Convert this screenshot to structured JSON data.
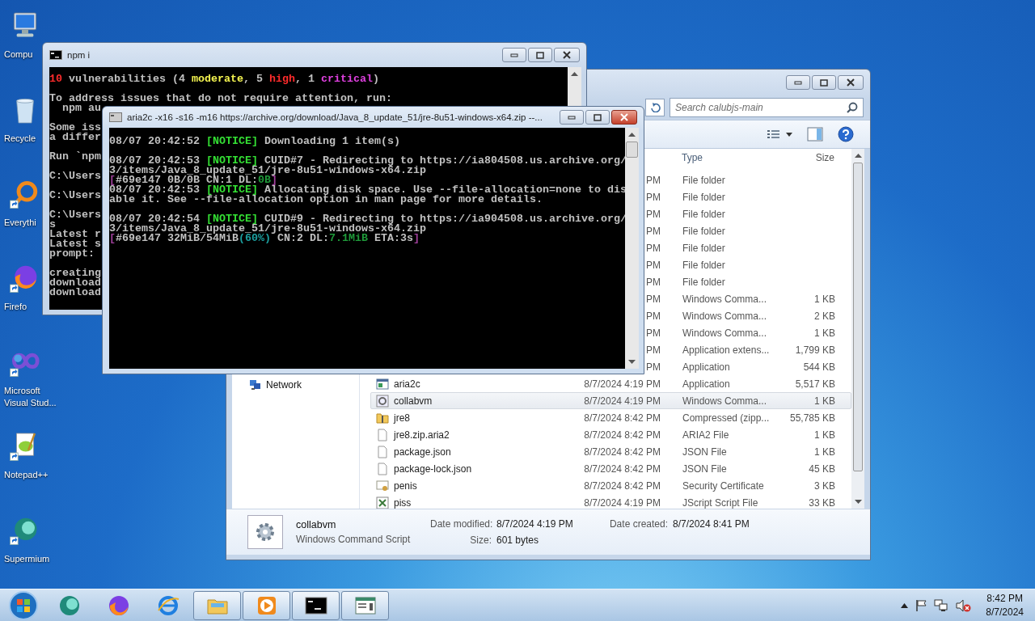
{
  "desktop_icons": [
    {
      "label": "Compu",
      "kind": "computer",
      "shortcut": false
    },
    {
      "label": "Recycle",
      "kind": "bin",
      "shortcut": false
    },
    {
      "label": "Everythi",
      "kind": "ring",
      "shortcut": true
    },
    {
      "label": "Firefo",
      "kind": "fox",
      "shortcut": true
    },
    {
      "label": "Microsoft Visual Stud...",
      "kind": "loop",
      "shortcut": true
    },
    {
      "label": "Notepad++",
      "kind": "notepad",
      "shortcut": true
    },
    {
      "label": "Supermium",
      "kind": "sphere",
      "shortcut": true
    }
  ],
  "explorer": {
    "search": {
      "placeholder": "Search calubjs-main"
    },
    "columns": [
      "Type",
      "Size"
    ],
    "nav_items": [
      "Network"
    ],
    "rows": [
      {
        "date": "PM",
        "type": "File folder",
        "selected": false
      },
      {
        "date": "PM",
        "type": "File folder",
        "selected": false
      },
      {
        "date": "PM",
        "type": "File folder",
        "selected": false
      },
      {
        "date": "PM",
        "type": "File folder",
        "selected": false
      },
      {
        "date": "PM",
        "type": "File folder",
        "selected": false
      },
      {
        "date": "PM",
        "type": "File folder",
        "selected": false
      },
      {
        "date": "PM",
        "type": "File folder",
        "selected": false
      },
      {
        "date": "PM",
        "type": "Windows Comma...",
        "size": "1 KB",
        "selected": false
      },
      {
        "date": "PM",
        "type": "Windows Comma...",
        "size": "2 KB",
        "selected": false
      },
      {
        "date": "PM",
        "type": "Windows Comma...",
        "size": "1 KB",
        "selected": false
      },
      {
        "date": "PM",
        "type": "Application extens...",
        "size": "1,799 KB",
        "selected": false
      },
      {
        "date": "PM",
        "type": "Application",
        "size": "544 KB",
        "selected": false
      },
      {
        "name": "aria2c",
        "kind": "app",
        "date": "8/7/2024 4:19 PM",
        "type": "Application",
        "size": "5,517 KB",
        "selected": false
      },
      {
        "name": "collabvm",
        "kind": "script",
        "date": "8/7/2024 4:19 PM",
        "type": "Windows Comma...",
        "size": "1 KB",
        "selected": true
      },
      {
        "name": "jre8",
        "kind": "zip",
        "date": "8/7/2024 8:42 PM",
        "type": "Compressed (zipp...",
        "size": "55,785 KB",
        "selected": false
      },
      {
        "name": "jre8.zip.aria2",
        "kind": "file",
        "date": "8/7/2024 8:42 PM",
        "type": "ARIA2 File",
        "size": "1 KB",
        "selected": false
      },
      {
        "name": "package.json",
        "kind": "file",
        "date": "8/7/2024 8:42 PM",
        "type": "JSON File",
        "size": "1 KB",
        "selected": false
      },
      {
        "name": "package-lock.json",
        "kind": "file",
        "date": "8/7/2024 8:42 PM",
        "type": "JSON File",
        "size": "45 KB",
        "selected": false
      },
      {
        "name": "penis",
        "kind": "cert",
        "date": "8/7/2024 8:42 PM",
        "type": "Security Certificate",
        "size": "3 KB",
        "selected": false
      },
      {
        "name": "piss",
        "kind": "jscript",
        "date": "8/7/2024 4:19 PM",
        "type": "JScript Script File",
        "size": "33 KB",
        "selected": false
      }
    ],
    "details": {
      "name": "collabvm",
      "type": "Windows Command Script",
      "fields": [
        {
          "label": "Date modified:",
          "value": "8/7/2024 4:19 PM"
        },
        {
          "label": "Date created:",
          "value": "8/7/2024 8:41 PM"
        },
        {
          "label": "Size:",
          "value": "601 bytes"
        }
      ]
    }
  },
  "npm_window": {
    "title": "npm i",
    "lines": [
      {
        "spaced": false,
        "segments": [
          {
            "text": "10",
            "kind": "alert"
          },
          {
            "text": " vulnerabilities (4 ",
            "kind": "plain"
          },
          {
            "text": "moderate",
            "kind": "moderate"
          },
          {
            "text": ", 5 ",
            "kind": "plain"
          },
          {
            "text": "high",
            "kind": "alert"
          },
          {
            "text": ", 1 ",
            "kind": "plain"
          },
          {
            "text": "critical",
            "kind": "critical"
          },
          {
            "text": ")",
            "kind": "plain"
          }
        ]
      },
      {
        "spaced": true,
        "segments": [
          {
            "text": "To address issues that do not require attention, run:",
            "kind": "plain"
          }
        ]
      },
      {
        "spaced": false,
        "segments": [
          {
            "text": "  npm au",
            "kind": "plain"
          }
        ]
      },
      {
        "spaced": true,
        "segments": [
          {
            "text": "Some iss",
            "kind": "plain"
          }
        ]
      },
      {
        "spaced": false,
        "segments": [
          {
            "text": "a differ",
            "kind": "plain"
          }
        ]
      },
      {
        "spaced": true,
        "segments": [
          {
            "text": "Run `npm",
            "kind": "plain"
          }
        ]
      },
      {
        "spaced": true,
        "segments": [
          {
            "text": "C:\\Users",
            "kind": "plain"
          }
        ]
      },
      {
        "spaced": true,
        "segments": [
          {
            "text": "C:\\Users",
            "kind": "plain"
          }
        ]
      },
      {
        "spaced": true,
        "segments": [
          {
            "text": "C:\\Users",
            "kind": "plain"
          }
        ]
      },
      {
        "spaced": false,
        "segments": [
          {
            "text": "s",
            "kind": "plain"
          }
        ]
      },
      {
        "spaced": false,
        "segments": [
          {
            "text": "Latest r",
            "kind": "plain"
          }
        ]
      },
      {
        "spaced": false,
        "segments": [
          {
            "text": "Latest s",
            "kind": "plain"
          }
        ]
      },
      {
        "spaced": false,
        "segments": [
          {
            "text": "prompt:",
            "kind": "plain"
          }
        ]
      },
      {
        "spaced": true,
        "segments": [
          {
            "text": "creating",
            "kind": "plain"
          }
        ]
      },
      {
        "spaced": false,
        "segments": [
          {
            "text": "download",
            "kind": "plain"
          }
        ]
      },
      {
        "spaced": false,
        "segments": [
          {
            "text": "download",
            "kind": "plain"
          }
        ]
      }
    ]
  },
  "aria_window": {
    "title": "aria2c  -x16 -s16 -m16 https://archive.org/download/Java_8_update_51/jre-8u51-windows-x64.zip --...",
    "lines": [
      {
        "spaced": false,
        "segments": [
          {
            "text": "08/07 20:42:52 ",
            "kind": "plain"
          },
          {
            "text": "[NOTICE]",
            "kind": "notice"
          },
          {
            "text": " Downloading 1 item(s)",
            "kind": "plain"
          }
        ]
      },
      {
        "spaced": true,
        "segments": [
          {
            "text": "08/07 20:42:53 ",
            "kind": "plain"
          },
          {
            "text": "[NOTICE]",
            "kind": "notice"
          },
          {
            "text": " CUID#7 - Redirecting to https://ia804508.us.archive.org/",
            "kind": "plain"
          }
        ]
      },
      {
        "spaced": false,
        "segments": [
          {
            "text": "3/items/Java_8_update_51/jre-8u51-windows-x64.zip",
            "kind": "plain"
          }
        ]
      },
      {
        "spaced": false,
        "segments": [
          {
            "text": "[",
            "kind": "bracket"
          },
          {
            "text": "#69e147 0B/0B CN:1 DL:",
            "kind": "plain"
          },
          {
            "text": "0B",
            "kind": "value"
          },
          {
            "text": "]",
            "kind": "bracket"
          }
        ]
      },
      {
        "spaced": false,
        "segments": [
          {
            "text": "08/07 20:42:53 ",
            "kind": "plain"
          },
          {
            "text": "[NOTICE]",
            "kind": "notice"
          },
          {
            "text": " Allocating disk space. Use --file-allocation=none to dis",
            "kind": "plain"
          }
        ]
      },
      {
        "spaced": false,
        "segments": [
          {
            "text": "able it. See --file-allocation option in man page for more details.",
            "kind": "plain"
          }
        ]
      },
      {
        "spaced": true,
        "segments": [
          {
            "text": "08/07 20:42:54 ",
            "kind": "plain"
          },
          {
            "text": "[NOTICE]",
            "kind": "notice"
          },
          {
            "text": " CUID#9 - Redirecting to https://ia904508.us.archive.org/",
            "kind": "plain"
          }
        ]
      },
      {
        "spaced": false,
        "segments": [
          {
            "text": "3/items/Java_8_update_51/jre-8u51-windows-x64.zip",
            "kind": "plain"
          }
        ]
      },
      {
        "spaced": false,
        "segments": [
          {
            "text": "[",
            "kind": "bracket"
          },
          {
            "text": "#69e147 32MiB/54MiB",
            "kind": "plain"
          },
          {
            "text": "(60%)",
            "kind": "percent"
          },
          {
            "text": " CN:2 DL:",
            "kind": "plain"
          },
          {
            "text": "7.1MiB",
            "kind": "value"
          },
          {
            "text": " ETA:3s",
            "kind": "plain"
          },
          {
            "text": "]",
            "kind": "bracket"
          }
        ]
      }
    ]
  },
  "taskbar": {
    "items": [
      {
        "kind": "sphere",
        "running": false
      },
      {
        "kind": "fox",
        "running": false
      },
      {
        "kind": "browser",
        "running": false
      },
      {
        "kind": "folder",
        "running": true
      },
      {
        "kind": "player",
        "running": true
      },
      {
        "kind": "console",
        "running": true
      },
      {
        "kind": "window",
        "running": true
      }
    ],
    "clock": {
      "time": "8:42 PM",
      "date": "8/7/2024"
    }
  }
}
